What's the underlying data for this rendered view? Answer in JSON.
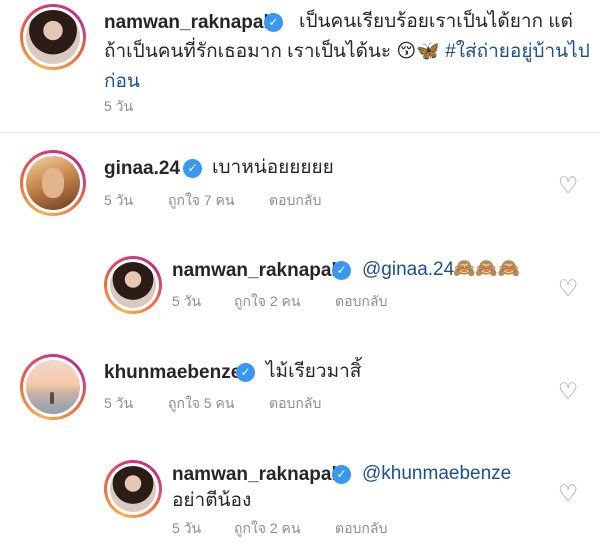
{
  "caption": {
    "username": "namwan_raknapak",
    "text_line1": "เป็นคนเรียบร้อยเราเป็นได้ยาก แต่",
    "text_line2a": "ถ้าเป็นคนที่รักเธอมาก เราเป็นได้นะ",
    "emoji": "😚🦋",
    "hashtag_part1": "#ใส่ถ่ายอยู่บ้านไป",
    "hashtag_part2": "ก่อน",
    "time": "5 วัน"
  },
  "comments": [
    {
      "username": "ginaa.24",
      "text": "เบาหน่อยยยยย",
      "time": "5 วัน",
      "likes": "ถูกใจ 7 คน",
      "reply_label": "ตอบกลับ"
    },
    {
      "username": "namwan_raknapak",
      "mention": "@ginaa.24",
      "emoji": "🙈🙈🙈",
      "time": "5 วัน",
      "likes": "ถูกใจ 2 คน",
      "reply_label": "ตอบกลับ"
    },
    {
      "username": "khunmaebenze",
      "text": "ไม้เรียวมาสิ้",
      "time": "5 วัน",
      "likes": "ถูกใจ 5 คน",
      "reply_label": "ตอบกลับ"
    },
    {
      "username": "namwan_raknapak",
      "mention": "@khunmaebenze",
      "text_line2": "อย่าตีน้อง",
      "time": "5 วัน",
      "likes": "ถูกใจ 2 คน",
      "reply_label": "ตอบกลับ"
    }
  ],
  "icons": {
    "verified": "verified-badge-icon",
    "like": "heart-outline-icon"
  },
  "colors": {
    "link": "#1c4f8e",
    "verified": "#3897f0",
    "meta": "#8e8e8e"
  }
}
